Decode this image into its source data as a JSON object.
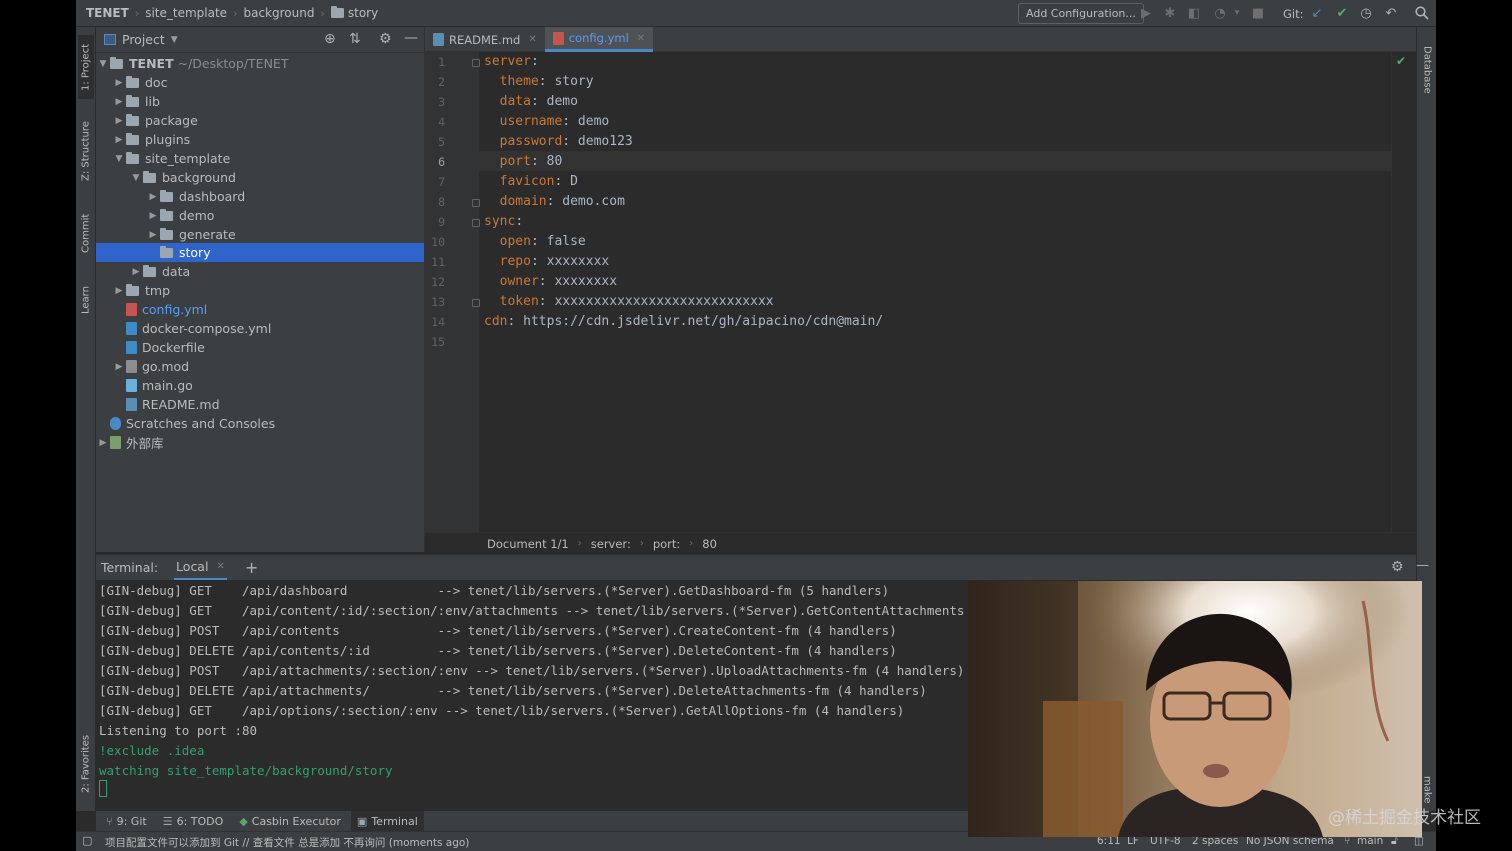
{
  "topbar": {
    "breadcrumbs": [
      "TENET",
      "site_template",
      "background",
      "story"
    ],
    "add_config_label": "Add Configuration...",
    "git_label": "Git:"
  },
  "left_tools": [
    "1: Project",
    "Z: Structure",
    "Commit",
    "Learn",
    "2: Favorites"
  ],
  "right_tools": [
    "Database",
    "make"
  ],
  "project": {
    "title": "Project",
    "root_name": "TENET",
    "root_path": "~/Desktop/TENET",
    "items": [
      {
        "label": "doc",
        "kind": "folder"
      },
      {
        "label": "lib",
        "kind": "folder"
      },
      {
        "label": "package",
        "kind": "folder"
      },
      {
        "label": "plugins",
        "kind": "folder"
      },
      {
        "label": "site_template",
        "kind": "folder"
      },
      {
        "label": "background",
        "kind": "folder"
      },
      {
        "label": "dashboard",
        "kind": "folder"
      },
      {
        "label": "demo",
        "kind": "folder"
      },
      {
        "label": "generate",
        "kind": "folder"
      },
      {
        "label": "story",
        "kind": "folder"
      },
      {
        "label": "data",
        "kind": "folder"
      },
      {
        "label": "tmp",
        "kind": "folder"
      },
      {
        "label": "config.yml",
        "kind": "yaml"
      },
      {
        "label": "docker-compose.yml",
        "kind": "yaml"
      },
      {
        "label": "Dockerfile",
        "kind": "docker"
      },
      {
        "label": "go.mod",
        "kind": "gomod"
      },
      {
        "label": "main.go",
        "kind": "go"
      },
      {
        "label": "README.md",
        "kind": "md"
      },
      {
        "label": "Scratches and Consoles",
        "kind": "scratch"
      },
      {
        "label": "外部库",
        "kind": "lib"
      }
    ]
  },
  "editor": {
    "tabs": [
      {
        "label": "README.md",
        "active": false
      },
      {
        "label": "config.yml",
        "active": true
      }
    ],
    "line_numbers": [
      "1",
      "2",
      "3",
      "4",
      "5",
      "6",
      "7",
      "8",
      "9",
      "10",
      "11",
      "12",
      "13",
      "14",
      "15"
    ],
    "lines": [
      {
        "key": "server",
        "value": ""
      },
      {
        "key": "  theme",
        "value": " story"
      },
      {
        "key": "  data",
        "value": " demo"
      },
      {
        "key": "  username",
        "value": " demo"
      },
      {
        "key": "  password",
        "value": " demo123"
      },
      {
        "key": "  port",
        "value": " 80"
      },
      {
        "key": "  favicon",
        "value": " D"
      },
      {
        "key": "  domain",
        "value": " demo.com"
      },
      {
        "key": "sync",
        "value": ""
      },
      {
        "key": "  open",
        "value": " false"
      },
      {
        "key": "  repo",
        "value": " xxxxxxxx"
      },
      {
        "key": "  owner",
        "value": " xxxxxxxx"
      },
      {
        "key": "  token",
        "value": " xxxxxxxxxxxxxxxxxxxxxxxxxxxx"
      },
      {
        "key": "cdn",
        "value": " https://cdn.jsdelivr.net/gh/aipacino/cdn@main/"
      },
      {
        "key": "",
        "value": ""
      }
    ],
    "breadcrumb": [
      "Document 1/1",
      "server:",
      "port:",
      "80"
    ]
  },
  "terminal": {
    "title": "Terminal:",
    "tab_label": "Local",
    "lines": [
      "[GIN-debug] GET    /api/dashboard            --> tenet/lib/servers.(*Server).GetDashboard-fm (5 handlers)",
      "[GIN-debug] GET    /api/content/:id/:section/:env/attachments --> tenet/lib/servers.(*Server).GetContentAttachments",
      "[GIN-debug] POST   /api/contents             --> tenet/lib/servers.(*Server).CreateContent-fm (4 handlers)",
      "[GIN-debug] DELETE /api/contents/:id         --> tenet/lib/servers.(*Server).DeleteContent-fm (4 handlers)",
      "[GIN-debug] POST   /api/attachments/:section/:env --> tenet/lib/servers.(*Server).UploadAttachments-fm (4 handlers)",
      "[GIN-debug] DELETE /api/attachments/         --> tenet/lib/servers.(*Server).DeleteAttachments-fm (4 handlers)",
      "[GIN-debug] GET    /api/options/:section/:env --> tenet/lib/servers.(*Server).GetAllOptions-fm (4 handlers)",
      "Listening to port :80",
      "!exclude .idea",
      "watching site_template/background/story"
    ]
  },
  "bottom_tools": [
    "9: Git",
    "6: TODO",
    "Casbin Executor",
    "Terminal"
  ],
  "status": {
    "message": "项目配置文件可以添加到 Git // 查看文件   总是添加   不再询问 (moments ago)",
    "position": "6:11",
    "line_sep": "LF",
    "encoding": "UTF-8",
    "indent": "2 spaces",
    "schema": "No JSON schema",
    "branch": "main"
  },
  "watermark": "@稀土掘金技术社区",
  "colors": {
    "accent": "#2f65ca",
    "yaml_key": "#cc7832",
    "terminal_green": "#32a06e",
    "active_tab": "#589df6"
  }
}
